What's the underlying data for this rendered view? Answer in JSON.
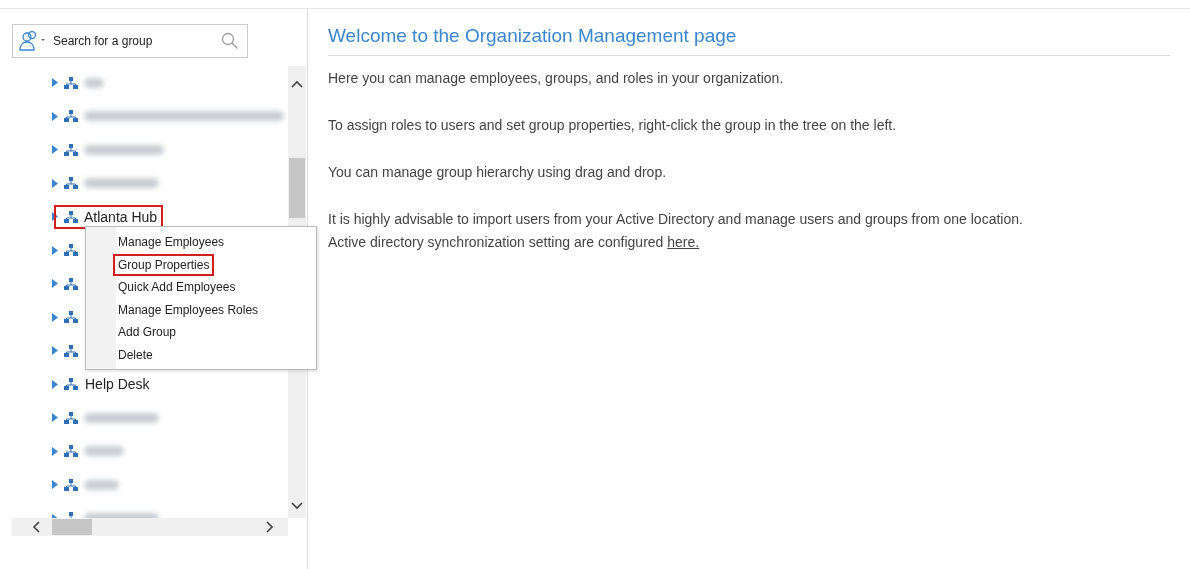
{
  "search": {
    "placeholder": "Search for a group"
  },
  "tree": {
    "items": [
      {
        "kind": "blurred"
      },
      {
        "kind": "blurred"
      },
      {
        "kind": "blurred"
      },
      {
        "kind": "blurred"
      },
      {
        "kind": "text",
        "label": "Atlanta Hub",
        "outlined": true
      },
      {
        "kind": "hidden"
      },
      {
        "kind": "hidden"
      },
      {
        "kind": "hidden"
      },
      {
        "kind": "hidden"
      },
      {
        "kind": "text",
        "label": "Help Desk",
        "outlined": false
      },
      {
        "kind": "blurred"
      },
      {
        "kind": "blurred"
      },
      {
        "kind": "blurred"
      },
      {
        "kind": "blurred"
      }
    ]
  },
  "context_menu": {
    "items": [
      {
        "label": "Manage Employees",
        "outlined": false
      },
      {
        "label": "Group Properties",
        "outlined": true
      },
      {
        "label": "Quick Add Employees",
        "outlined": false
      },
      {
        "label": "Manage Employees Roles",
        "outlined": false
      },
      {
        "label": "Add Group",
        "outlined": false
      },
      {
        "label": "Delete",
        "outlined": false
      }
    ]
  },
  "main": {
    "title": "Welcome to the Organization Management page",
    "paragraphs": [
      {
        "text": "Here you can manage employees, groups, and roles in your organization."
      },
      {
        "text": "To assign roles to users and set group properties, right-click the group in the tree on the left."
      },
      {
        "text": "You can manage group hierarchy using drag and drop."
      },
      {
        "text": "It is highly advisable to import users from your Active Directory and manage users and groups from one location.",
        "second_line": "Active directory synchronization setting are configured ",
        "link": "here."
      }
    ]
  }
}
